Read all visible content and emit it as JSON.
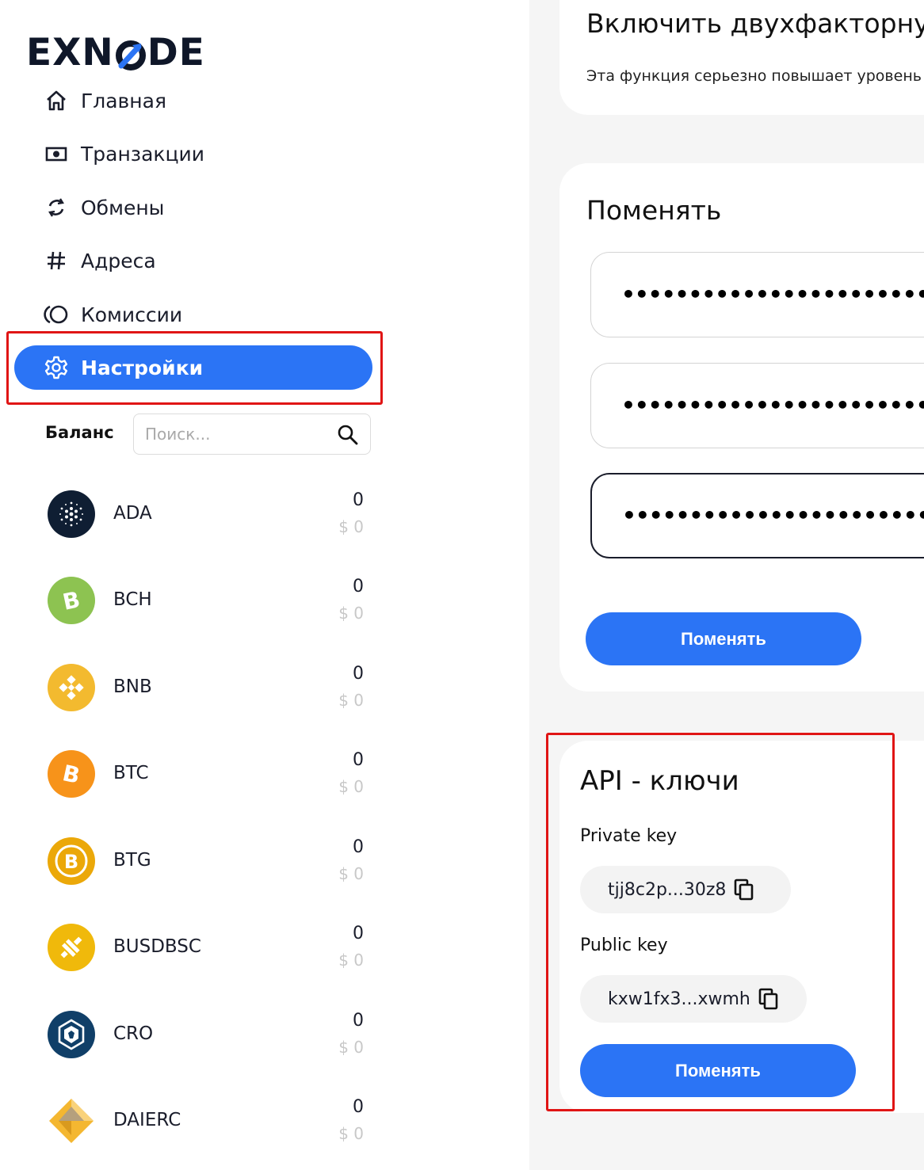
{
  "logo": {
    "text_left": "EXN",
    "text_right": "DE"
  },
  "nav": {
    "items": [
      {
        "label": "Главная",
        "icon": "home-icon"
      },
      {
        "label": "Транзакции",
        "icon": "cash-icon"
      },
      {
        "label": "Обмены",
        "icon": "refresh-icon"
      },
      {
        "label": "Адреса",
        "icon": "hash-icon"
      },
      {
        "label": "Комиссии",
        "icon": "commission-icon"
      },
      {
        "label": "Настройки",
        "icon": "gear-icon",
        "active": true
      }
    ]
  },
  "balance": {
    "label": "Баланс",
    "search_placeholder": "Поиск..."
  },
  "coins": [
    {
      "name": "ADA",
      "amount": "0",
      "usd": "$ 0",
      "color": "#0f1e33"
    },
    {
      "name": "BCH",
      "amount": "0",
      "usd": "$ 0",
      "color": "#8dc351"
    },
    {
      "name": "BNB",
      "amount": "0",
      "usd": "$ 0",
      "color": "#f3ba2f"
    },
    {
      "name": "BTC",
      "amount": "0",
      "usd": "$ 0",
      "color": "#f7931a"
    },
    {
      "name": "BTG",
      "amount": "0",
      "usd": "$ 0",
      "color": "#eba809"
    },
    {
      "name": "BUSDBSC",
      "amount": "0",
      "usd": "$ 0",
      "color": "#f0b90b"
    },
    {
      "name": "CRO",
      "amount": "0",
      "usd": "$ 0",
      "color": "#103f68"
    },
    {
      "name": "DAIERC",
      "amount": "0",
      "usd": "$ 0",
      "color": "#f4b731"
    }
  ],
  "two_factor": {
    "title": "Включить двухфакторну",
    "description": "Эта функция серьезно повышает уровень"
  },
  "password": {
    "title": "Поменять",
    "field1": "•••••••••••••••••••••••••",
    "field2": "•••••••••••••••••••••••••",
    "field3": "•••••••••••••••••••••••••",
    "button": "Поменять"
  },
  "api": {
    "title": "API - ключи",
    "private_label": "Private key",
    "private_value": "tjj8c2p...30z8",
    "public_label": "Public key",
    "public_value": "kxw1fx3...xwmh",
    "button": "Поменять"
  },
  "colors": {
    "accent": "#2b74f5",
    "highlight": "#e01515",
    "main_bg": "#f5f5f5"
  }
}
